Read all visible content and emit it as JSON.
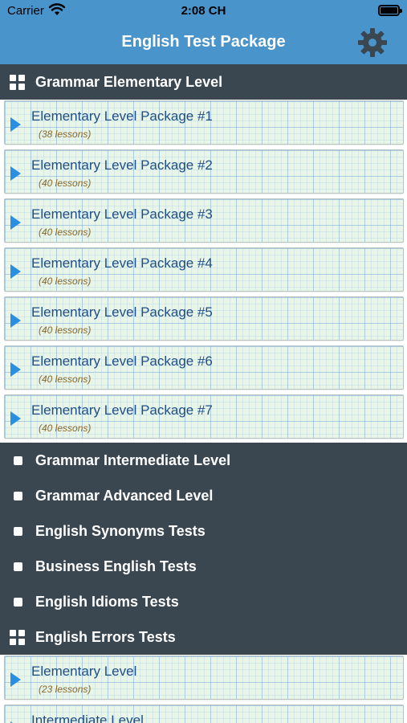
{
  "status": {
    "carrier": "Carrier",
    "time": "2:08 CH",
    "wifi_icon": "wifi-icon",
    "battery_icon": "battery-icon"
  },
  "nav": {
    "title": "English Test Package",
    "settings_icon": "gear-icon"
  },
  "colors": {
    "nav_bg": "#4a94cc",
    "section_bg": "#3a4750",
    "row_bg": "#e9f5e6",
    "row_title": "#1f4e86",
    "row_count": "#8a6a2b",
    "arrow": "#2a8fe0"
  },
  "sections": [
    {
      "label": "Grammar Elementary Level",
      "icon": "grid-icon",
      "expanded": true,
      "packages": [
        {
          "name": "Elementary Level Package #1",
          "count": "(38 lessons)"
        },
        {
          "name": "Elementary Level Package #2",
          "count": "(40 lessons)"
        },
        {
          "name": "Elementary Level Package #3",
          "count": "(40 lessons)"
        },
        {
          "name": "Elementary Level Package #4",
          "count": "(40 lessons)"
        },
        {
          "name": "Elementary Level Package #5",
          "count": "(40 lessons)"
        },
        {
          "name": "Elementary Level Package #6",
          "count": "(40 lessons)"
        },
        {
          "name": "Elementary Level Package #7",
          "count": "(40 lessons)"
        }
      ]
    },
    {
      "label": "Grammar Intermediate Level",
      "icon": "square-icon",
      "expanded": false
    },
    {
      "label": "Grammar Advanced Level",
      "icon": "square-icon",
      "expanded": false
    },
    {
      "label": "English Synonyms Tests",
      "icon": "square-icon",
      "expanded": false
    },
    {
      "label": "Business English Tests",
      "icon": "square-icon",
      "expanded": false
    },
    {
      "label": "English Idioms Tests",
      "icon": "square-icon",
      "expanded": false
    },
    {
      "label": "English Errors Tests",
      "icon": "grid-icon",
      "expanded": true,
      "packages": [
        {
          "name": "Elementary Level",
          "count": "(23 lessons)"
        },
        {
          "name": "Intermediate Level",
          "count": ""
        }
      ]
    }
  ]
}
